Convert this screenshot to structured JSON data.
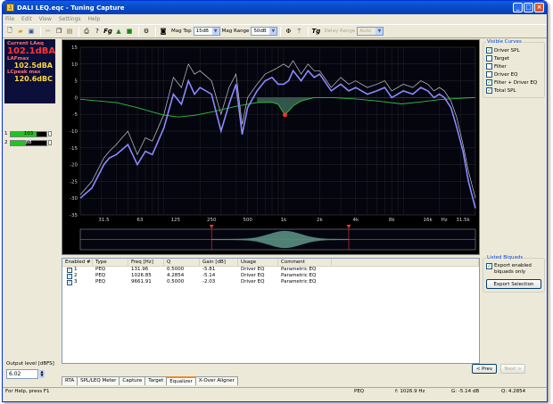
{
  "window": {
    "title": "DALI LEQ.eqc - Tuning Capture"
  },
  "menu": [
    "File",
    "Edit",
    "View",
    "Settings",
    "Help"
  ],
  "toolbar": {
    "mag_top_label": "Mag Top",
    "mag_top_value": "15dB",
    "mag_range_label": "Mag Range",
    "mag_range_value": "50dB",
    "delay_range_label": "Delay Range",
    "delay_range_value": "Auto",
    "fg_label": "Fg",
    "tg_label": "Tg"
  },
  "meter": {
    "current_label": "Current LAeq",
    "current_value": "102.1dBA",
    "lafmax_label": "LAFmax",
    "lafmax_value": "102.5dBA",
    "lcpeak_label": "LCpeak max",
    "lcpeak_value": "120.6dBC"
  },
  "levels": [
    {
      "channel": "1",
      "value": "103",
      "fill_pct": 72
    },
    {
      "channel": "2",
      "value": "88",
      "fill_pct": 42
    }
  ],
  "output": {
    "label": "Output level [dBFS]",
    "value": "6.02"
  },
  "visible_curves": {
    "title": "Visible Curves",
    "items": [
      {
        "label": "Driver SPL",
        "checked": true
      },
      {
        "label": "Target",
        "checked": false
      },
      {
        "label": "Filter",
        "checked": false
      },
      {
        "label": "Driver EQ",
        "checked": false
      },
      {
        "label": "Filter + Driver EQ",
        "checked": true
      },
      {
        "label": "Total SPL",
        "checked": true
      }
    ]
  },
  "listed_biquads": {
    "title": "Listed Biquads",
    "export_enabled_label": "Export enabled biquads only",
    "export_selection_label": "Export Selection"
  },
  "table": {
    "headers": [
      "Enabled #",
      "Type",
      "Freq [Hz]",
      "Q",
      "Gain [dB]",
      "Usage",
      "Comment"
    ],
    "rows": [
      {
        "n": "1",
        "type": "PEQ",
        "freq": "131.96",
        "q": "0.5000",
        "gain": "-5.81",
        "usage": "Driver EQ",
        "comment": "Parametric EQ"
      },
      {
        "n": "2",
        "type": "PEQ",
        "freq": "1026.85",
        "q": "4.2854",
        "gain": "-5.14",
        "usage": "Driver EQ",
        "comment": "Parametric EQ"
      },
      {
        "n": "3",
        "type": "PEQ",
        "freq": "9661.91",
        "q": "0.5000",
        "gain": "-2.03",
        "usage": "Driver EQ",
        "comment": "Parametric EQ"
      }
    ]
  },
  "nav": {
    "prev_label": "< Prev",
    "next_label": "Next >"
  },
  "tabs": [
    "RTA",
    "SPL/LEQ Meter",
    "Capture",
    "Target",
    "Equalizer",
    "X-Over Aligner"
  ],
  "status": {
    "help": "For Help, press F1",
    "type": "PEQ",
    "freq": "f: 1026.9 Hz",
    "gain": "G: -5.14 dB",
    "q": "Q: 4.2854"
  },
  "chart_data": {
    "type": "line",
    "xscale": "log",
    "xlim": [
      20,
      40000
    ],
    "ylim": [
      -35,
      15
    ],
    "y_ticks": [
      15,
      10,
      5,
      0,
      -5,
      -10,
      -15,
      -20,
      -25,
      -30,
      -35
    ],
    "x_ticks": [
      "31.5",
      "63",
      "125",
      "250",
      "500",
      "1k",
      "2k",
      "4k",
      "8k",
      "16k",
      "Hz",
      "31.5k"
    ],
    "x_tick_values": [
      31.5,
      63,
      125,
      250,
      500,
      1000,
      2000,
      4000,
      8000,
      16000,
      22000,
      31500
    ],
    "grid": true,
    "colors": {
      "driver_spl": "#c8c8c8",
      "filter_driver_eq": "#2fbf3c",
      "total_spl": "#8a8aff",
      "marker": "#ff3030"
    },
    "series": [
      {
        "key": "driver_spl",
        "x": [
          20,
          25,
          31.5,
          35,
          40,
          50,
          60,
          70,
          80,
          100,
          120,
          140,
          160,
          180,
          200,
          250,
          300,
          350,
          400,
          450,
          500,
          600,
          700,
          800,
          900,
          1000,
          1100,
          1200,
          1400,
          1600,
          1800,
          2000,
          2500,
          3000,
          3500,
          4000,
          5000,
          6000,
          7000,
          8000,
          10000,
          12000,
          14000,
          16000,
          18000,
          20000,
          22000,
          25000,
          28000,
          31500,
          35000,
          40000
        ],
        "y": [
          -29,
          -25,
          -18,
          -16,
          -14,
          -10,
          -17,
          -12,
          -13,
          -5,
          6,
          3,
          10,
          7,
          8,
          5,
          -5,
          3,
          7,
          -8,
          0,
          4,
          7,
          8,
          9,
          10,
          9,
          11,
          7,
          10,
          8,
          8,
          3,
          6,
          4,
          5,
          3,
          4,
          5,
          2,
          4,
          3,
          5,
          4,
          2,
          3,
          2,
          -1,
          -6,
          -14,
          -22,
          -30
        ]
      },
      {
        "key": "filter_driver_eq",
        "x": [
          20,
          40,
          60,
          80,
          100,
          132,
          180,
          250,
          400,
          600,
          800,
          900,
          1000,
          1027,
          1100,
          1200,
          1400,
          1800,
          2500,
          4000,
          6000,
          9662,
          14000,
          20000,
          30000,
          40000
        ],
        "y": [
          -0.5,
          -1.5,
          -3,
          -4.3,
          -5.2,
          -5.8,
          -5.3,
          -4.3,
          -2.6,
          -1.5,
          -1.4,
          -2,
          -4.6,
          -5,
          -4,
          -2.5,
          -1,
          0,
          0,
          -0.4,
          -1,
          -1.9,
          -1.3,
          -0.6,
          -0.2,
          0
        ]
      },
      {
        "key": "total_spl",
        "x": [
          20,
          25,
          31.5,
          35,
          40,
          50,
          60,
          70,
          80,
          100,
          120,
          140,
          160,
          180,
          200,
          250,
          300,
          350,
          400,
          450,
          500,
          600,
          700,
          800,
          900,
          1000,
          1100,
          1200,
          1400,
          1600,
          1800,
          2000,
          2500,
          3000,
          3500,
          4000,
          5000,
          6000,
          7000,
          8000,
          10000,
          12000,
          14000,
          16000,
          18000,
          20000,
          22000,
          25000,
          28000,
          31500,
          35000,
          40000
        ],
        "y": [
          -30,
          -27,
          -20,
          -18,
          -17,
          -14,
          -20,
          -16,
          -17,
          -9,
          1,
          -2,
          5,
          1,
          3,
          1,
          -10,
          -2,
          4,
          -11,
          -3,
          2,
          5,
          6,
          4,
          4,
          5,
          8,
          5,
          8,
          6,
          7,
          2,
          4,
          2,
          3,
          1,
          2,
          3,
          0,
          2,
          1,
          3,
          2,
          0,
          1,
          0,
          -3,
          -9,
          -16,
          -25,
          -33
        ]
      }
    ],
    "markers": [
      {
        "x": 1027,
        "y": -5.14
      }
    ],
    "filter_strip_markers": [
      250,
      3500
    ]
  }
}
